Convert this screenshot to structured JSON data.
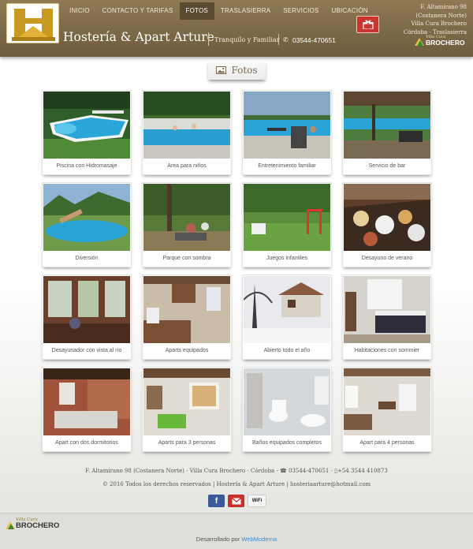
{
  "header": {
    "nav": [
      "INICIO",
      "CONTACTO Y TARIFAS",
      "FOTOS",
      "TRASLASIERRA",
      "SERVICIOS",
      "UBICACIÓN"
    ],
    "active_nav": "FOTOS",
    "brand": "Hostería & Apart Arture",
    "tagline": "Tranquilo y Familiar",
    "phone": "03544-470651",
    "address_lines": [
      "F. Altamirano 98",
      "(Costanera Norte)",
      "Villa Cura Brochero",
      "Córdoba - Traslasierra"
    ],
    "partner_logo_small": "Villa Cura",
    "partner_logo_big": "BROCHERO",
    "gift_icon": "gift-icon",
    "accent": "#7c6947"
  },
  "section_title": "Fotos",
  "photos": [
    {
      "caption": "Piscina con Hidromasaje"
    },
    {
      "caption": "Area para niños"
    },
    {
      "caption": "Entretenimiento familiar"
    },
    {
      "caption": "Servicio de bar"
    },
    {
      "caption": "Diversión"
    },
    {
      "caption": "Parque con sombra"
    },
    {
      "caption": "Juegos infantiles"
    },
    {
      "caption": "Desayuno de verano"
    },
    {
      "caption": "Desayunador con vista al río"
    },
    {
      "caption": "Aparts equipados"
    },
    {
      "caption": "Abierto todo el año"
    },
    {
      "caption": "Habitaciones con sommier"
    },
    {
      "caption": "Apart con dos dormitorios"
    },
    {
      "caption": "Aparts para 3 personas"
    },
    {
      "caption": "Baños equipados completos"
    },
    {
      "caption": "Apart para 4 personas"
    }
  ],
  "footer": {
    "line1": "F. Altamirano 98 (Costanera Norte) - Villa Cura Brochero - Córdoba - ☎ 03544-470651 - ▯+54 3544 410873",
    "line2": "© 2016 Todos los derechos reservados | Hostería & Apart Arture | hosteriaarture@hotmail.com",
    "social": [
      "facebook-icon",
      "mail-icon",
      "wifi-icon"
    ],
    "facebook_label": "f",
    "wifi_label": "WiFi",
    "partner_logo_small": "Villa Cura",
    "partner_logo_big": "BROCHERO",
    "dev_prefix": "Desarrollado por",
    "dev_link": "WebModerna"
  }
}
